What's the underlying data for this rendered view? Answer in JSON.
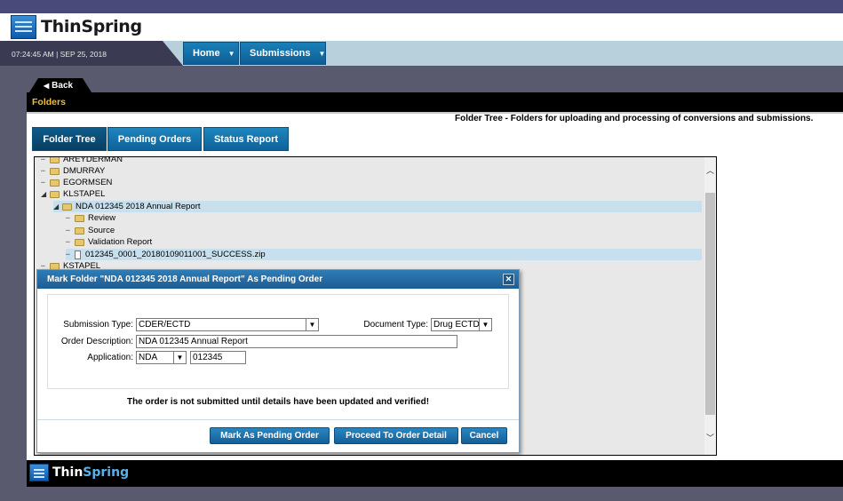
{
  "header": {
    "logo_thin": "Thin",
    "logo_spring": "Spring",
    "datetime": "07:24:45 AM | SEP 25, 2018",
    "nav": [
      {
        "label": "Home"
      },
      {
        "label": "Submissions"
      }
    ]
  },
  "back_label": "Back",
  "section_title": "Folders",
  "description": "Folder Tree  - Folders for uploading and processing of conversions and submissions.",
  "tabs": [
    {
      "label": "Folder Tree",
      "active": true
    },
    {
      "label": "Pending Orders",
      "active": false
    },
    {
      "label": "Status Report",
      "active": false
    }
  ],
  "tree": {
    "items": [
      {
        "label": "AREYDERMAN",
        "type": "folder"
      },
      {
        "label": "DMURRAY",
        "type": "folder"
      },
      {
        "label": "EGORMSEN",
        "type": "folder"
      },
      {
        "label": "KLSTAPEL",
        "type": "folder"
      },
      {
        "label": "NDA 012345 2018 Annual Report",
        "type": "folder"
      },
      {
        "label": "Review",
        "type": "folder"
      },
      {
        "label": "Source",
        "type": "folder"
      },
      {
        "label": "Validation Report",
        "type": "folder"
      },
      {
        "label": "012345_0001_20180109011001_SUCCESS.zip",
        "type": "file"
      },
      {
        "label": "KSTAPEL",
        "type": "folder"
      }
    ]
  },
  "dialog": {
    "title": "Mark Folder \"NDA 012345 2018 Annual Report\" As Pending Order",
    "submission_type_label": "Submission Type:",
    "submission_type_value": "CDER/ECTD",
    "document_type_label": "Document Type:",
    "document_type_value": "Drug ECTD",
    "order_description_label": "Order Description:",
    "order_description_value": "NDA 012345 Annual Report",
    "application_label": "Application:",
    "application_type_value": "NDA",
    "application_number_value": "012345",
    "warning": "The order is not submitted until details have been updated and verified!",
    "buttons": {
      "mark": "Mark As Pending Order",
      "proceed": "Proceed To Order Detail",
      "cancel": "Cancel"
    }
  },
  "footer": {
    "logo_thin": "Thin",
    "logo_spring": "Spring"
  },
  "colors": {
    "accent": "#1576b0",
    "section_title": "#f0c030",
    "selected_row": "#c8dfee"
  }
}
